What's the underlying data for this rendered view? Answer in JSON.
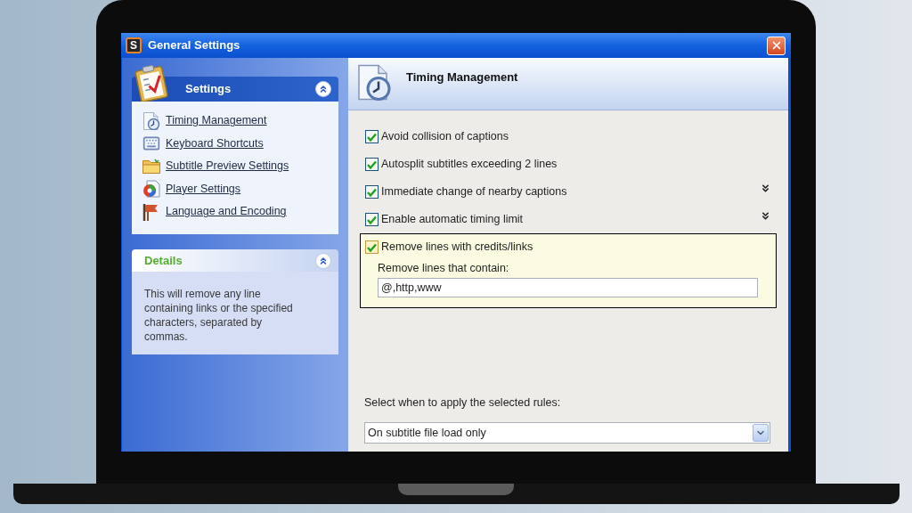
{
  "window": {
    "title": "General Settings",
    "logo_text": "S"
  },
  "sidebar": {
    "settings_panel": {
      "title": "Settings",
      "expanded": true,
      "items": [
        {
          "label": "Timing Management"
        },
        {
          "label": "Keyboard Shortcuts"
        },
        {
          "label": "Subtitle Preview Settings"
        },
        {
          "label": "Player Settings"
        },
        {
          "label": "Language and Encoding"
        }
      ]
    },
    "details_panel": {
      "title": "Details",
      "expanded": true,
      "text": "This will remove any line containing links or the specified characters, separated by commas."
    }
  },
  "content": {
    "title": "Timing Management",
    "options": [
      {
        "kind": "plain",
        "label": "Avoid collision of captions",
        "checked": true,
        "selected": false
      },
      {
        "kind": "plain",
        "label": "Autosplit subtitles exceeding 2 lines",
        "checked": true,
        "selected": false
      },
      {
        "kind": "expandable",
        "label": "Immediate change of nearby captions",
        "checked": true,
        "selected": false,
        "expanded": false
      },
      {
        "kind": "expandable",
        "label": "Enable automatic timing limit",
        "checked": true,
        "selected": false,
        "expanded": false
      },
      {
        "kind": "with_field",
        "label": "Remove lines with credits/links",
        "checked": true,
        "selected": true,
        "field_label": "Remove lines that contain:",
        "value": "@,http,www"
      }
    ],
    "apply_rules": {
      "label": "Select when to apply the selected rules:",
      "value": "On subtitle file load only"
    }
  }
}
